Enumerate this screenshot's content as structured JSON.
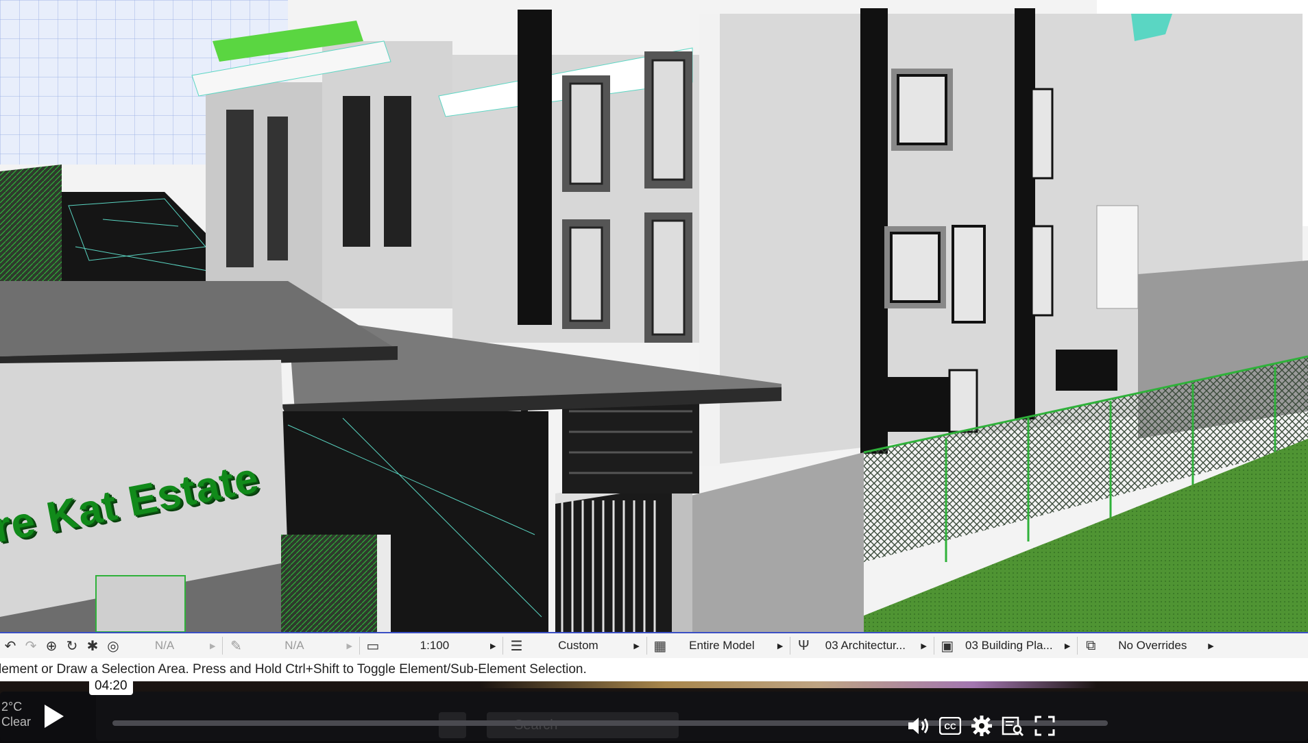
{
  "viewport": {
    "sign_text": "ire Kat Estate"
  },
  "toolbar": {
    "layer_combo": "N/A",
    "pen_set": "N/A",
    "scale": "1:100",
    "structure": "Custom",
    "partial_display": "Entire Model",
    "pen_set_model": "03 Architectur...",
    "model_view": "03 Building Pla...",
    "overrides": "No Overrides"
  },
  "status": {
    "message": "lement or Draw a Selection Area. Press and Hold Ctrl+Shift to Toggle Element/Sub-Element Selection."
  },
  "player": {
    "tooltip_time": "04:20",
    "progress": 0.0,
    "weather_temp": "2°C",
    "weather_desc": "Clear",
    "search_ghost": "Search"
  },
  "colors": {
    "accent": "#3a4fc4",
    "sign_green": "#118a1a",
    "grass": "#4c8f33"
  }
}
